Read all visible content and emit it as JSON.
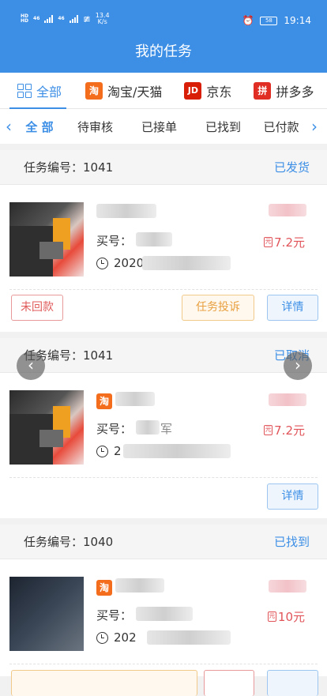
{
  "statusbar": {
    "network_left": "HD",
    "speed": "13.4",
    "speed_unit": "K/s",
    "signal_top": "46",
    "signal_bot": "46",
    "time": "19:14",
    "battery": "58"
  },
  "header": {
    "title": "我的任务"
  },
  "platform_tabs": [
    {
      "label": "全部",
      "icon": "grid-icon"
    },
    {
      "label": "淘宝/天猫",
      "icon": "taobao-icon",
      "icon_text": "淘",
      "icon_color": "#f36d1c"
    },
    {
      "label": "京东",
      "icon": "jd-icon",
      "icon_text": "JD",
      "icon_color": "#d81e06"
    },
    {
      "label": "拼多多",
      "icon": "pinduoduo-icon",
      "icon_text": "拼",
      "icon_color": "#e02e24"
    }
  ],
  "status_tabs": [
    "全 部",
    "待审核",
    "已接单",
    "已找到",
    "已付款"
  ],
  "colors": {
    "primary": "#3d8fe6",
    "price": "#e0545a"
  },
  "orders": [
    {
      "id_label": "任务编号：",
      "id": "1041",
      "status": "已发货",
      "buyer_label": "买号：",
      "date_prefix": "2020",
      "price": "7.2元",
      "buttons": [
        "未回款",
        "任务投诉",
        "详情"
      ]
    },
    {
      "id_label": "任务编号：",
      "id": "1041",
      "status": "已取消",
      "buyer_label": "买号：",
      "buyer_suffix": "军",
      "date_prefix": "2",
      "price": "7.2元",
      "buttons": [
        "详情"
      ]
    },
    {
      "id_label": "任务编号：",
      "id": "1040",
      "status": "已找到",
      "buyer_label": "买号：",
      "date_prefix": "202",
      "price": "10元",
      "buttons": []
    }
  ],
  "taobao_badge": "淘",
  "price_icon_text": "元"
}
